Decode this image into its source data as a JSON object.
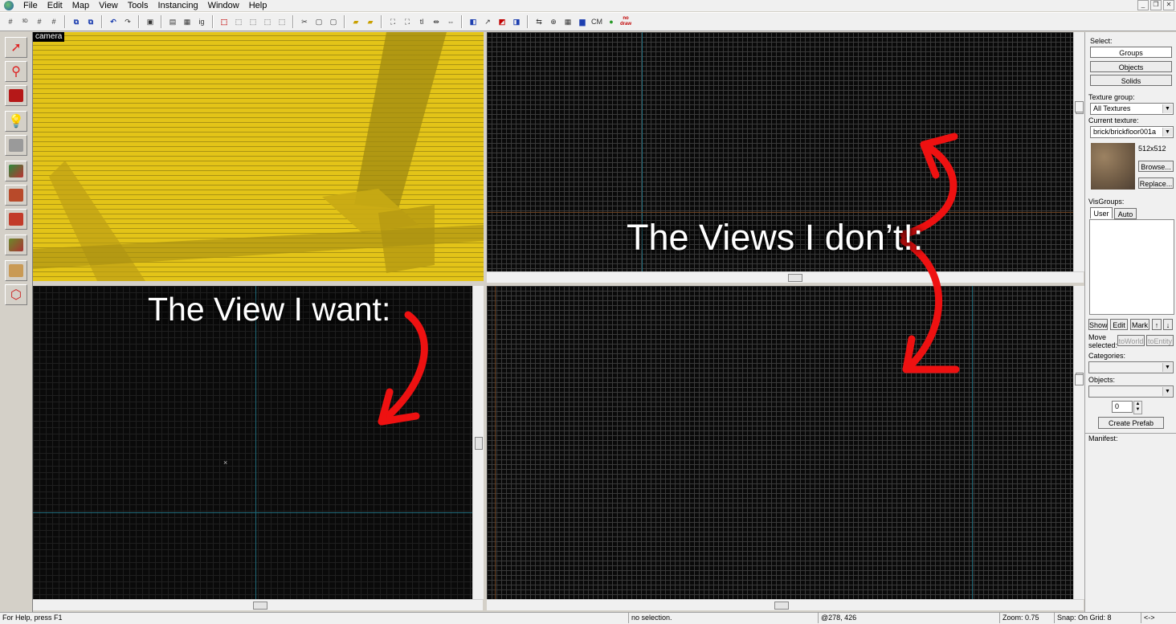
{
  "menu": [
    "File",
    "Edit",
    "Map",
    "View",
    "Tools",
    "Instancing",
    "Window",
    "Help"
  ],
  "toolbar": {
    "icons": [
      "grid-icon",
      "3d-grid-icon",
      "grid-larger-icon",
      "grid-smaller-icon",
      "group-icon",
      "ungroup-icon",
      "undo-icon",
      "redo-icon",
      "carve-icon",
      "hollow-icon",
      "copy-icon",
      "paste-icon",
      "ignore-groups-icon",
      "tl-icon",
      "flip-icon",
      "cordon-icon",
      "texture-lock-icon",
      "vertex-icon",
      "mirror-icon",
      "run-map-icon",
      "camera-icon",
      "cm-icon",
      "leaf-icon",
      "no-draw-icon"
    ],
    "text_buttons": {
      "ig": "ig",
      "tl": "tl",
      "cm": "CM",
      "nodraw": "no draw"
    }
  },
  "left_tools": [
    "selection-tool",
    "magnify-tool",
    "camera-tool",
    "entity-tool",
    "block-tool",
    "texture-application-tool",
    "apply-decals-tool",
    "overlay-tool",
    "clipping-tool",
    "vertex-tool",
    "path-tool"
  ],
  "camera_label": "camera",
  "captions": {
    "want": "The View I want:",
    "dont": "The Views I don’t!:"
  },
  "right_panel": {
    "select_label": "Select:",
    "groups": "Groups",
    "objects": "Objects",
    "solids": "Solids",
    "texture_group_label": "Texture group:",
    "texture_group_value": "All Textures",
    "current_texture_label": "Current texture:",
    "current_texture_value": "brick/brickfloor001a",
    "texture_size": "512x512",
    "browse": "Browse...",
    "replace": "Replace...",
    "visgroups_label": "VisGroups:",
    "tab_user": "User",
    "tab_auto": "Auto",
    "show": "Show",
    "edit": "Edit",
    "mark": "Mark",
    "up_arrow": "↑",
    "down_arrow": "↓",
    "move_selected": "Move selected:",
    "to_world": "toWorld",
    "to_entity": "toEntity",
    "categories_label": "Categories:",
    "objects_label": "Objects:",
    "count_value": "0",
    "create_prefab": "Create Prefab",
    "manifest_label": "Manifest:"
  },
  "status": {
    "help": "For Help, press F1",
    "selection": "no selection.",
    "coords": "@278, 426",
    "zoom": "Zoom: 0.75",
    "snap": "Snap: On Grid: 8",
    "arrows": "<->"
  },
  "colors": {
    "camera_yellow": "#e3c418",
    "arrow_red": "#ee1111",
    "axis_teal": "#1f6a7a"
  }
}
